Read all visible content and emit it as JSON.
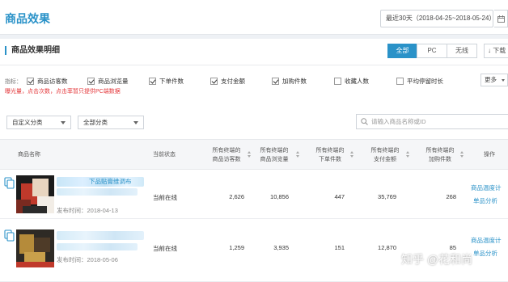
{
  "header": {
    "title": "商品效果",
    "date_range": "最近30天（2018-04-25~2018-05-24）",
    "calendar_icon": "calendar-icon"
  },
  "panel": {
    "section_title": "商品效果明细",
    "segments": [
      "全部",
      "PC",
      "无线"
    ],
    "active_segment": "全部",
    "download_label": "下载",
    "indicator_label": "指标：",
    "indicators": [
      {
        "label": "商品访客数",
        "checked": true
      },
      {
        "label": "商品浏览量",
        "checked": true
      },
      {
        "label": "下单件数",
        "checked": true
      },
      {
        "label": "支付金额",
        "checked": true
      },
      {
        "label": "加购件数",
        "checked": true
      },
      {
        "label": "收藏人数",
        "checked": false
      },
      {
        "label": "平均停留时长",
        "checked": false
      }
    ],
    "more_label": "更多",
    "hint": "曝光量，点击次数，点击率暂只提供PC端数据",
    "filters": {
      "custom_category": "自定义分类",
      "all_category": "全部分类",
      "search_placeholder": "请输入商品名称或ID"
    }
  },
  "table": {
    "headers": {
      "name": "商品名称",
      "status": "当前状态",
      "visitors": [
        "所有终端的",
        "商品访客数"
      ],
      "views": [
        "所有终端的",
        "商品浏览量"
      ],
      "orders": [
        "所有终端的",
        "下单件数"
      ],
      "pay": [
        "所有终端的",
        "支付金额"
      ],
      "cart": [
        "所有终端的",
        "加购件数"
      ],
      "ops": "操作"
    },
    "rows": [
      {
        "name": "下品贴膏维调布",
        "date": "发布时间：2018-04-13",
        "status": "当前在线",
        "visitors": "2,626",
        "views": "10,856",
        "orders": "447",
        "pay": "35,769",
        "cart": "268",
        "ops": [
          "商品温度计",
          "单品分析"
        ]
      },
      {
        "name": "",
        "date": "发布时间：2018-05-06",
        "status": "当前在线",
        "visitors": "1,259",
        "views": "3,935",
        "orders": "151",
        "pay": "12,870",
        "cart": "85",
        "ops": [
          "商品温度计",
          "单品分析"
        ]
      }
    ]
  },
  "watermark": "知乎 @花和尚",
  "colors": {
    "accent": "#2a92c8",
    "warning": "#e4393c"
  }
}
